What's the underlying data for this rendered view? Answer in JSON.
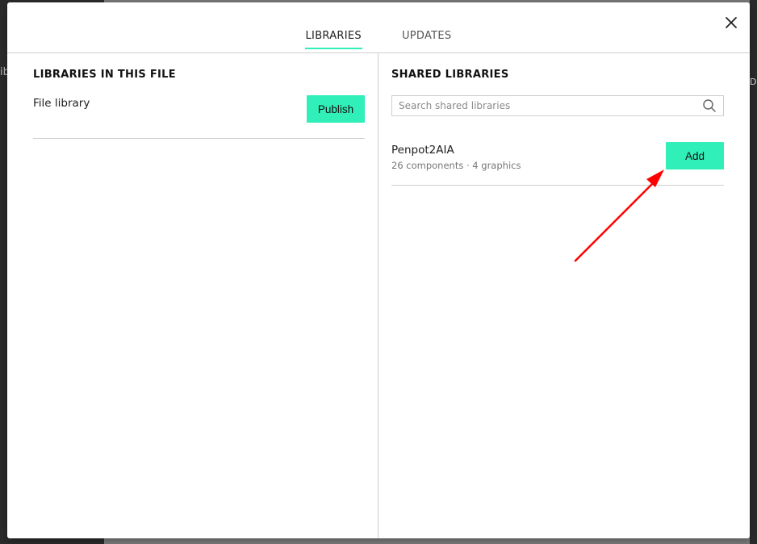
{
  "tabs": [
    {
      "label": "LIBRARIES",
      "active": true
    },
    {
      "label": "UPDATES",
      "active": false
    }
  ],
  "left": {
    "title": "LIBRARIES IN THIS FILE",
    "library_name": "File library",
    "publish_label": "Publish"
  },
  "right": {
    "title": "SHARED LIBRARIES",
    "search_placeholder": "Search shared libraries",
    "libraries": [
      {
        "name": "Penpot2AIA",
        "meta": "26 components · 4 graphics",
        "add_label": "Add"
      }
    ]
  },
  "background": {
    "left_fragment": "ib",
    "right_fragment": "DE"
  },
  "colors": {
    "accent": "#31efb8",
    "annotation_arrow": "#ff0000"
  },
  "icons": {
    "close": "close-icon",
    "search": "search-icon"
  }
}
